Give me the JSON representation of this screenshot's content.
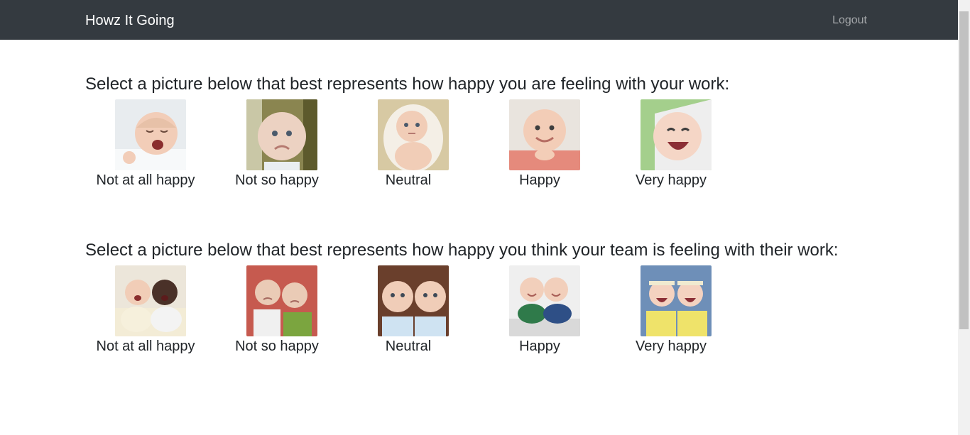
{
  "navbar": {
    "brand": "Howz It Going",
    "logout_label": "Logout"
  },
  "sections": [
    {
      "prompt": "Select a picture below that best represents how happy you are feeling with your work:",
      "options": [
        {
          "label": "Not at all happy",
          "icon": "crying-baby-icon"
        },
        {
          "label": "Not so happy",
          "icon": "frowning-baby-icon"
        },
        {
          "label": "Neutral",
          "icon": "neutral-baby-icon"
        },
        {
          "label": "Happy",
          "icon": "smiling-baby-icon"
        },
        {
          "label": "Very happy",
          "icon": "laughing-baby-icon"
        }
      ]
    },
    {
      "prompt": "Select a picture below that best represents how happy you think your team is feeling with their work:",
      "options": [
        {
          "label": "Not at all happy",
          "icon": "crying-twins-icon"
        },
        {
          "label": "Not so happy",
          "icon": "frowning-twins-icon"
        },
        {
          "label": "Neutral",
          "icon": "neutral-twins-icon"
        },
        {
          "label": "Happy",
          "icon": "smiling-twins-icon"
        },
        {
          "label": "Very happy",
          "icon": "laughing-twins-icon"
        }
      ]
    }
  ],
  "colors": {
    "navbar_bg": "#343a40",
    "brand_text": "#ffffff",
    "nav_link": "rgba(255,255,255,0.55)",
    "heading_text": "#212529"
  }
}
